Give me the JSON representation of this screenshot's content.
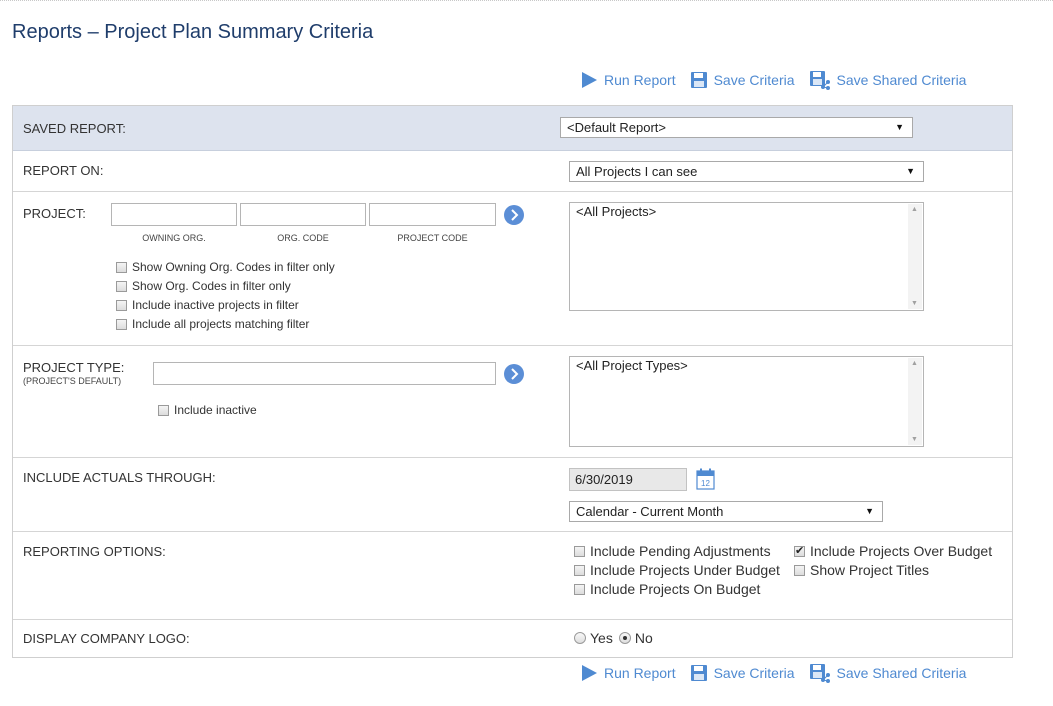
{
  "page": {
    "title": "Reports – Project Plan Summary Criteria"
  },
  "colors": {
    "accent": "#4f8ad1",
    "title": "#1f3d6b",
    "saved_row_bg": "#dde3ee"
  },
  "actions": {
    "run_report": "Run Report",
    "save_criteria": "Save Criteria",
    "save_shared_criteria": "Save Shared Criteria"
  },
  "saved_report": {
    "label": "SAVED REPORT:",
    "value": "<Default Report>"
  },
  "report_on": {
    "label": "REPORT ON:",
    "value": "All Projects I can see"
  },
  "project": {
    "label": "PROJECT:",
    "captions": {
      "owning_org": "OWNING ORG.",
      "org_code": "ORG. CODE",
      "project_code": "PROJECT CODE"
    },
    "options": [
      {
        "label": "Show Owning Org. Codes in filter only",
        "checked": false
      },
      {
        "label": "Show Org. Codes in filter only",
        "checked": false
      },
      {
        "label": "Include inactive projects in filter",
        "checked": false
      },
      {
        "label": "Include all projects matching filter",
        "checked": false
      }
    ],
    "list_value": "<All Projects>"
  },
  "project_type": {
    "label": "PROJECT TYPE:",
    "sublabel": "(PROJECT'S DEFAULT)",
    "include_inactive": "Include inactive",
    "list_value": "<All Project Types>"
  },
  "actuals": {
    "label": "INCLUDE ACTUALS THROUGH:",
    "date": "6/30/2019",
    "calendar_day": "12",
    "period": "Calendar - Current Month"
  },
  "reporting_options": {
    "label": "REPORTING OPTIONS:",
    "items": [
      {
        "label": "Include Pending Adjustments",
        "checked": false
      },
      {
        "label": "Include Projects Under Budget",
        "checked": false
      },
      {
        "label": "Include Projects On Budget",
        "checked": false
      },
      {
        "label": "Include Projects Over Budget",
        "checked": true
      },
      {
        "label": "Show Project Titles",
        "checked": false
      }
    ]
  },
  "company_logo": {
    "label": "DISPLAY COMPANY LOGO:",
    "yes": "Yes",
    "no": "No",
    "selected": "No"
  }
}
